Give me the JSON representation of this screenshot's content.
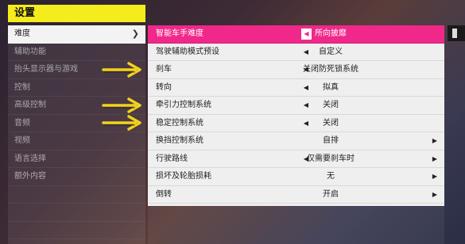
{
  "header": {
    "title": "设置"
  },
  "sidebar": {
    "items": [
      {
        "label": "难度",
        "active": true
      },
      {
        "label": "辅助功能"
      },
      {
        "label": "抬头显示器与游戏"
      },
      {
        "label": "控制"
      },
      {
        "label": "高级控制"
      },
      {
        "label": "音频"
      },
      {
        "label": "视频"
      },
      {
        "label": "语言选择"
      },
      {
        "label": "额外内容"
      },
      {
        "label": ""
      },
      {
        "label": ""
      },
      {
        "label": ""
      }
    ],
    "active_chevron": "chevron-right-icon"
  },
  "settings": {
    "rows": [
      {
        "label": "智能车手难度",
        "value": "所向披靡",
        "left_arrow": true,
        "right_arrow": false,
        "active": true
      },
      {
        "label": "驾驶辅助模式预设",
        "value": "自定义",
        "left_arrow": true,
        "right_arrow": false
      },
      {
        "label": "刹车",
        "value": "关闭防死锁系统",
        "left_arrow": true,
        "right_arrow": false
      },
      {
        "label": "转向",
        "value": "拟真",
        "left_arrow": true,
        "right_arrow": false
      },
      {
        "label": "牵引力控制系统",
        "value": "关闭",
        "left_arrow": true,
        "right_arrow": false
      },
      {
        "label": "稳定控制系统",
        "value": "关闭",
        "left_arrow": true,
        "right_arrow": false
      },
      {
        "label": "换挡控制系统",
        "value": "自排",
        "left_arrow": false,
        "right_arrow": true
      },
      {
        "label": "行驶路线",
        "value": "仅需要刹车时",
        "left_arrow": true,
        "right_arrow": true
      },
      {
        "label": "损坏及轮胎损耗",
        "value": "无",
        "left_arrow": false,
        "right_arrow": true
      },
      {
        "label": "倒转",
        "value": "开启",
        "left_arrow": false,
        "right_arrow": true
      }
    ]
  },
  "annotations": {
    "pointer_color": "#f2d21b",
    "pointers": [
      "刹车",
      "牵引力控制系统",
      "稳定控制系统"
    ]
  },
  "colors": {
    "accent": "#f0288a",
    "title_bg": "#f4ec1c"
  }
}
